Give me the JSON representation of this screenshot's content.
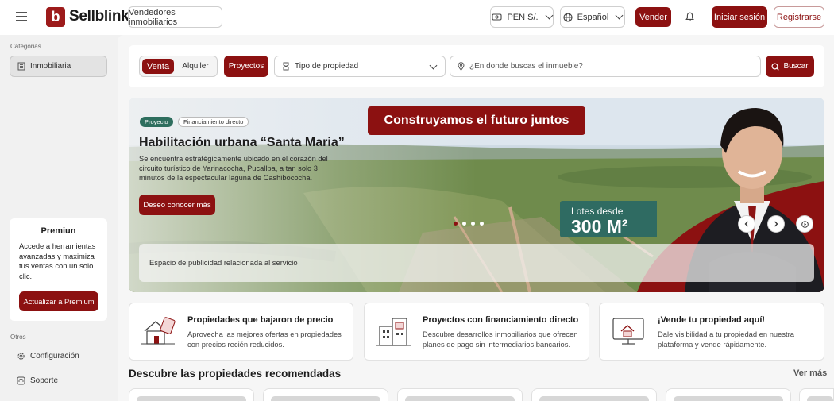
{
  "header": {
    "menu_icon": "hamburger-icon",
    "logo_letter": "b",
    "brand": "Sellblink",
    "agents_button": "Vendedores inmobiliarios",
    "currency": "PEN S/.",
    "currency_icon": "cash-icon",
    "language": "Español",
    "language_icon": "globe-icon",
    "sell_button": "Vender",
    "notifications_icon": "bell-icon",
    "login_button": "Iniciar sesión",
    "register_button": "Registrarse"
  },
  "sidebar": {
    "categories_label": "Categorias",
    "items": [
      {
        "label": "Inmobiliaria",
        "icon": "building-icon"
      }
    ],
    "premium": {
      "title": "Premiun",
      "text": "Accede a herramientas avanzadas y maximiza tus ventas con un solo clic.",
      "button": "Actualizar a Premium"
    },
    "others_label": "Otros",
    "others": [
      {
        "label": "Configuración",
        "icon": "gear-icon"
      },
      {
        "label": "Soporte",
        "icon": "support-icon"
      }
    ]
  },
  "search": {
    "tabs": [
      {
        "label": "Venta",
        "active": true
      },
      {
        "label": "Alquiler",
        "active": false
      }
    ],
    "projects_button": "Proyectos",
    "property_type": "Tipo de propiedad",
    "location_placeholder": "¿En donde buscas el inmueble?",
    "search_button": "Buscar"
  },
  "hero": {
    "badge_project": "Proyecto",
    "badge_finance": "Financiamiento directo",
    "headline": "Construyamos el futuro juntos",
    "title": "Habilitación urbana “Santa Maria”",
    "description": "Se encuentra estratégicamente ubicado en el corazón del circuito turístico de Yarinacocha, Pucallpa, a tan solo 3 minutos de la espectacular laguna de Cashibococha.",
    "cta": "Deseo conocer más",
    "lot_label": "Lotes desde",
    "lot_size": "300 M²",
    "ad_text": "Espacio de publicidad relacionada al servicio",
    "slides": 4,
    "active_slide": 0,
    "colors": {
      "accent": "#8c1111",
      "badge_green": "#2e6e5e",
      "lot_panel": "#2f6b62"
    }
  },
  "features": [
    {
      "title": "Propiedades que bajaron de precio",
      "description": "Aprovecha las mejores ofertas en propiedades con precios recién reducidos.",
      "icon": "price-drop-house-icon"
    },
    {
      "title": "Proyectos con financiamiento directo",
      "description": "Descubre desarrollos inmobiliarios que ofrecen planes de pago sin intermediarios bancarios.",
      "icon": "buildings-icon"
    },
    {
      "title": "¡Vende tu propiedad aquí!",
      "description": "Dale visibilidad a tu propiedad en nuestra plataforma y vende rápidamente.",
      "icon": "monitor-house-icon"
    }
  ],
  "recommended": {
    "title": "Descubre las propiedades recomendadas",
    "see_more": "Ver más"
  }
}
